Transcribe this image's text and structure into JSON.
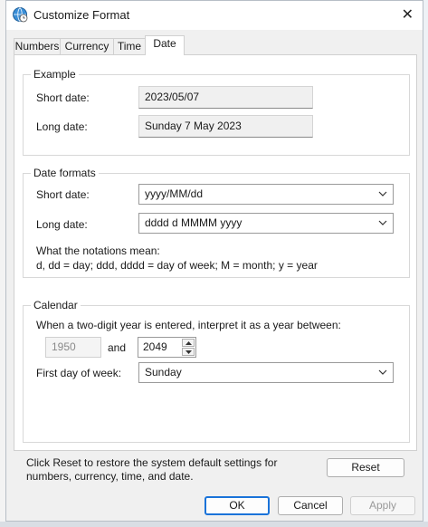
{
  "window": {
    "title": "Customize Format",
    "close_glyph": "✕"
  },
  "tabs": [
    {
      "label": "Numbers",
      "active": false
    },
    {
      "label": "Currency",
      "active": false
    },
    {
      "label": "Time",
      "active": false
    },
    {
      "label": "Date",
      "active": true
    }
  ],
  "example": {
    "group_label": "Example",
    "short_label": "Short date:",
    "short_value": "2023/05/07",
    "long_label": "Long date:",
    "long_value": "Sunday 7 May 2023"
  },
  "date_formats": {
    "group_label": "Date formats",
    "short_label": "Short date:",
    "short_value": "yyyy/MM/dd",
    "long_label": "Long date:",
    "long_value": "dddd d MMMM yyyy",
    "notation_title": "What the notations mean:",
    "notation_text": "d, dd = day;  ddd, dddd = day of week;  M = month;  y = year"
  },
  "calendar": {
    "group_label": "Calendar",
    "two_digit_text": "When a two-digit year is entered, interpret it as a year between:",
    "year_from": "1950",
    "and_label": "and",
    "year_to": "2049",
    "first_day_label": "First day of week:",
    "first_day_value": "Sunday"
  },
  "footer": {
    "reset_hint": "Click Reset to restore the system default settings for numbers, currency, time, and date.",
    "reset_label": "Reset",
    "ok_label": "OK",
    "cancel_label": "Cancel",
    "apply_label": "Apply"
  },
  "colors": {
    "accent": "#1a73d9",
    "panel": "#ffffff",
    "dialog": "#f0f0f0"
  }
}
